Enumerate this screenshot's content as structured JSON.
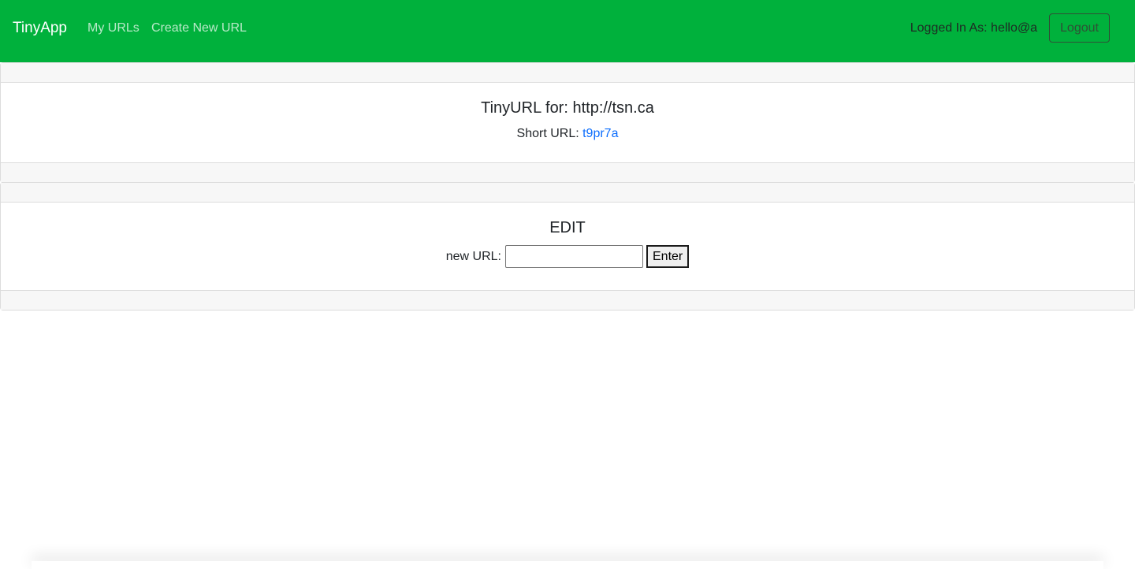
{
  "navbar": {
    "brand": "TinyApp",
    "links": [
      "My URLs",
      "Create New URL"
    ],
    "logged_in_text": "Logged In As: hello@a",
    "logout_label": "Logout"
  },
  "url_card": {
    "title": "TinyURL for: http://tsn.ca",
    "short_url_label": "Short URL: ",
    "short_url_value": "t9pr7a"
  },
  "edit_card": {
    "title": "EDIT",
    "input_label": "new URL:",
    "input_value": "",
    "submit_label": "Enter"
  },
  "colors": {
    "navbar_bg": "#00b13c",
    "link": "#0d6efd",
    "card_header_bg": "#f7f7f7"
  }
}
